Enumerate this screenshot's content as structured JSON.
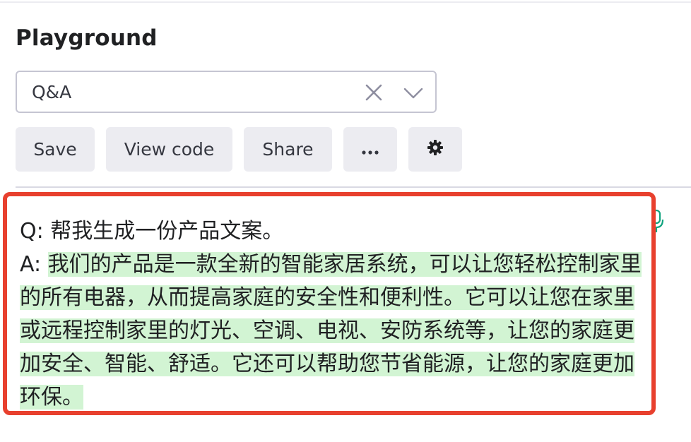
{
  "header": {
    "title": "Playground"
  },
  "preset": {
    "value": "Q&A"
  },
  "toolbar": {
    "save_label": "Save",
    "view_code_label": "View code",
    "share_label": "Share",
    "more_label": "···"
  },
  "output": {
    "question_line": "Q: 帮我生成一份产品文案。",
    "answer_prefix": "A:",
    "answer_text": "我们的产品是一款全新的智能家居系统，可以让您轻松控制家里的所有电器，从而提高家庭的安全性和便利性。它可以让您在家里或远程控制家里的灯光、空调、电视、安防系统等，让您的家庭更加安全、智能、舒适。它还可以帮助您节省能源，让您的家庭更加环保。"
  },
  "colors": {
    "highlight": "#d2f4d3",
    "frame": "#e8402e",
    "button_bg": "#ececf1"
  },
  "icons": {
    "clear": "close-icon",
    "dropdown": "chevron-down-icon",
    "more": "more-horizontal-icon",
    "settings": "gear-icon",
    "mic": "microphone-icon"
  }
}
